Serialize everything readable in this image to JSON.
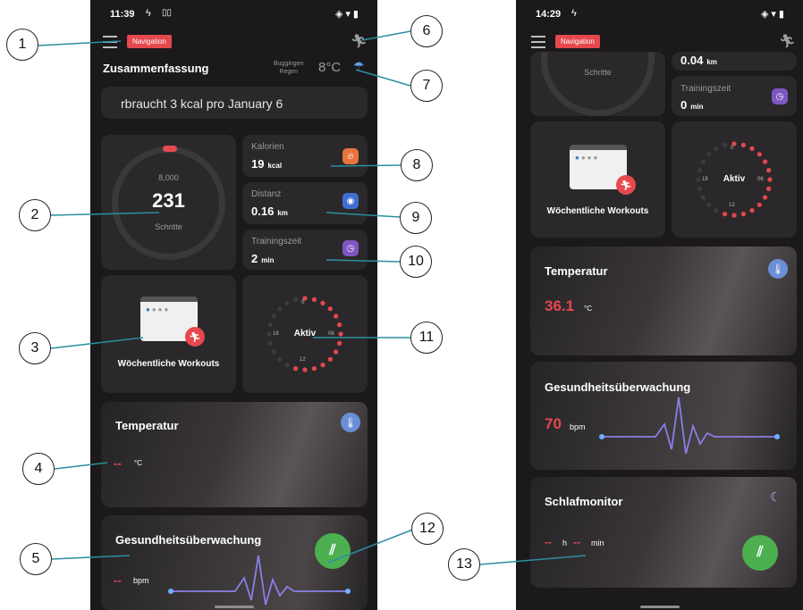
{
  "left": {
    "status_time": "11:39",
    "nav_tag": "Navigation",
    "section_title": "Zusammenfassung",
    "location": "Buggingen",
    "weather_text": "Regen",
    "temperature": "8°C",
    "ticker": "rbraucht 3 kcal pro January 6",
    "steps_goal": "8,000",
    "steps_value": "231",
    "steps_label": "Schritte",
    "calories_label": "Kalorien",
    "calories_value": "19",
    "calories_unit": "kcal",
    "distance_label": "Distanz",
    "distance_value": "0.16",
    "distance_unit": "km",
    "training_label": "Trainingszeit",
    "training_value": "2",
    "training_unit": "min",
    "workouts_label": "Wöchentliche Workouts",
    "activity_label": "Aktiv",
    "dial_0": "0",
    "dial_6": "06",
    "dial_12": "12",
    "dial_18": "18",
    "temp_title": "Temperatur",
    "temp_value": "--",
    "temp_unit": "°C",
    "health_title": "Gesundheitsüberwachung",
    "health_value": "--",
    "health_unit": "bpm"
  },
  "right": {
    "status_time": "14:29",
    "nav_tag": "Navigation",
    "distance_value": "0.04",
    "distance_unit": "km",
    "steps_label": "Schritte",
    "training_label": "Trainingszeit",
    "training_value": "0",
    "training_unit": "min",
    "workouts_label": "Wöchentliche Workouts",
    "activity_label": "Aktiv",
    "dial_0": "0",
    "dial_6": "06",
    "dial_12": "12",
    "dial_18": "18",
    "temp_title": "Temperatur",
    "temp_value": "36.1",
    "temp_unit": "°C",
    "health_title": "Gesundheitsüberwachung",
    "health_value": "70",
    "health_unit": "bpm",
    "sleep_title": "Schlafmonitor",
    "sleep_h_value": "--",
    "sleep_h_unit": "h",
    "sleep_m_value": "--",
    "sleep_m_unit": "min"
  },
  "callouts": [
    "1",
    "2",
    "3",
    "4",
    "5",
    "6",
    "7",
    "8",
    "9",
    "10",
    "11",
    "12",
    "13"
  ],
  "colors": {
    "accent_red": "#e5484d",
    "fab_green": "#4caf50",
    "card": "#2a282a",
    "bg": "#1b191b"
  },
  "icons": [
    "menu-icon",
    "runner-icon",
    "weather-rain-icon",
    "fire-icon",
    "location-icon",
    "stopwatch-icon",
    "calendar-icon",
    "thermometer-icon",
    "moon-icon",
    "sync-icon"
  ]
}
